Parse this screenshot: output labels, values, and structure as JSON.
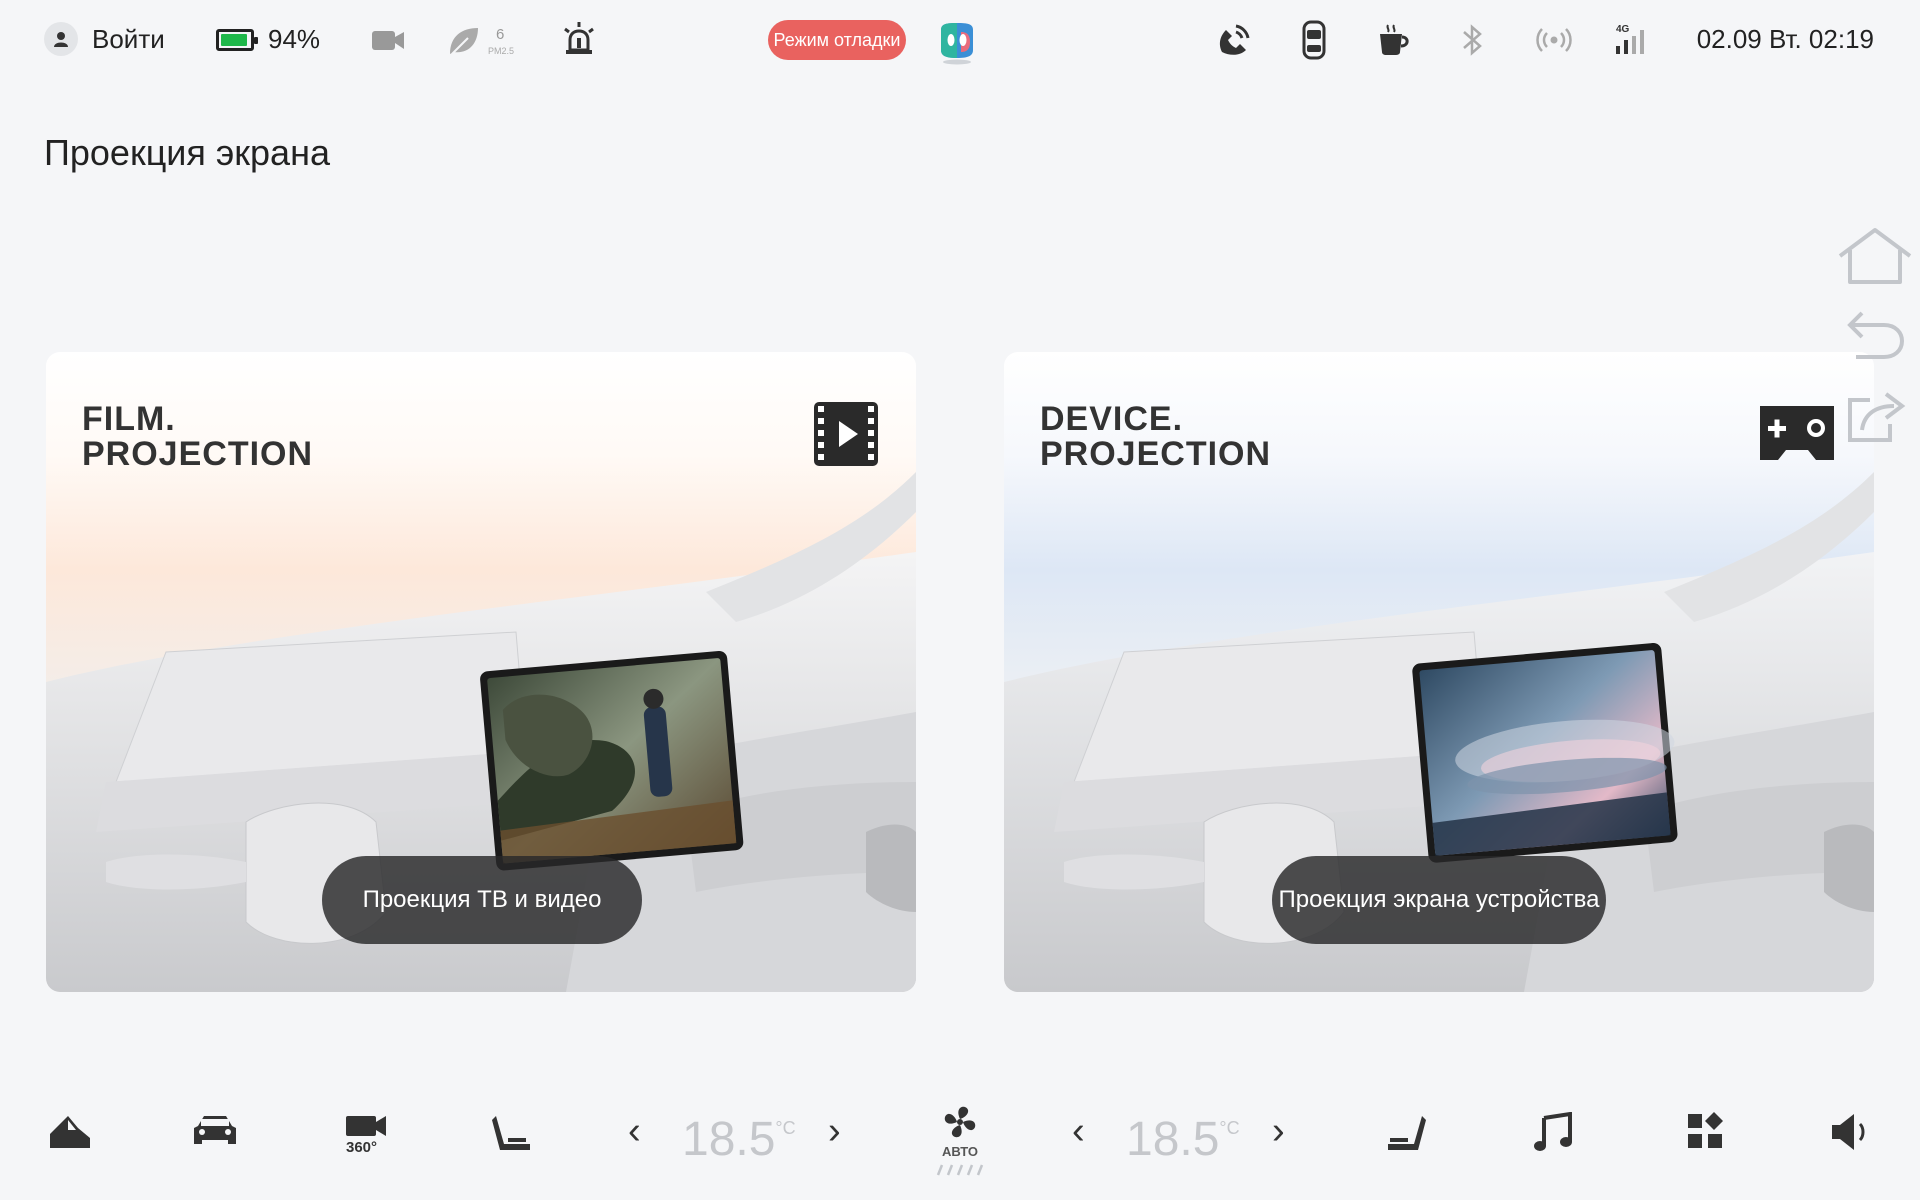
{
  "status_bar": {
    "login_label": "Войти",
    "battery_percent": "94%",
    "battery_level": 0.94,
    "pm_value": "6",
    "pm_unit": "PM2.5",
    "debug_mode_label": "Режим отладки",
    "datetime": "02.09 Вт. 02:19",
    "icons": [
      "user-icon",
      "battery-icon",
      "dashcam-icon",
      "leaf-icon",
      "alarm-icon",
      "assistant-icon",
      "phone-icon",
      "door-icon",
      "coffee-icon",
      "bluetooth-icon",
      "hotspot-icon",
      "signal-4g-icon"
    ],
    "colors": {
      "debug_pill": "#e9625f",
      "battery_fill": "#1fb84a"
    }
  },
  "page": {
    "title": "Проекция экрана"
  },
  "cards": [
    {
      "title_line1": "FILM.",
      "title_line2": "PROJECTION",
      "icon": "film-play-icon",
      "label": "Проекция ТВ и видео"
    },
    {
      "title_line1": "DEVICE.",
      "title_line2": "PROJECTION",
      "icon": "gamepad-icon",
      "label": "Проекция экрана устройства"
    }
  ],
  "side_controls": [
    "home-icon",
    "back-icon",
    "share-icon"
  ],
  "dock": {
    "left_temp": "18.5",
    "right_temp": "18.5",
    "temp_unit": "°C",
    "fan_mode_label": "АВТО",
    "icons": [
      "vehicle-side-icon",
      "car-icon",
      "camera-360-icon",
      "seat-icon",
      "fan-icon",
      "seat-heat-icon",
      "music-icon",
      "apps-icon",
      "volume-icon"
    ]
  }
}
